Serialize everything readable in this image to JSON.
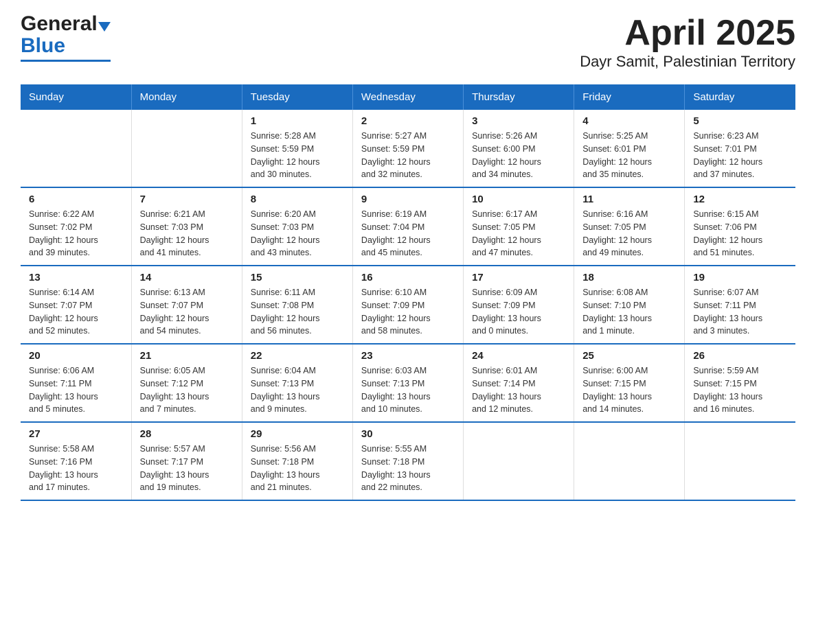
{
  "header": {
    "logo_general": "General",
    "logo_blue": "Blue",
    "title": "April 2025",
    "subtitle": "Dayr Samit, Palestinian Territory"
  },
  "calendar": {
    "days_of_week": [
      "Sunday",
      "Monday",
      "Tuesday",
      "Wednesday",
      "Thursday",
      "Friday",
      "Saturday"
    ],
    "weeks": [
      [
        {
          "day": "",
          "info": ""
        },
        {
          "day": "",
          "info": ""
        },
        {
          "day": "1",
          "info": "Sunrise: 5:28 AM\nSunset: 5:59 PM\nDaylight: 12 hours\nand 30 minutes."
        },
        {
          "day": "2",
          "info": "Sunrise: 5:27 AM\nSunset: 5:59 PM\nDaylight: 12 hours\nand 32 minutes."
        },
        {
          "day": "3",
          "info": "Sunrise: 5:26 AM\nSunset: 6:00 PM\nDaylight: 12 hours\nand 34 minutes."
        },
        {
          "day": "4",
          "info": "Sunrise: 5:25 AM\nSunset: 6:01 PM\nDaylight: 12 hours\nand 35 minutes."
        },
        {
          "day": "5",
          "info": "Sunrise: 6:23 AM\nSunset: 7:01 PM\nDaylight: 12 hours\nand 37 minutes."
        }
      ],
      [
        {
          "day": "6",
          "info": "Sunrise: 6:22 AM\nSunset: 7:02 PM\nDaylight: 12 hours\nand 39 minutes."
        },
        {
          "day": "7",
          "info": "Sunrise: 6:21 AM\nSunset: 7:03 PM\nDaylight: 12 hours\nand 41 minutes."
        },
        {
          "day": "8",
          "info": "Sunrise: 6:20 AM\nSunset: 7:03 PM\nDaylight: 12 hours\nand 43 minutes."
        },
        {
          "day": "9",
          "info": "Sunrise: 6:19 AM\nSunset: 7:04 PM\nDaylight: 12 hours\nand 45 minutes."
        },
        {
          "day": "10",
          "info": "Sunrise: 6:17 AM\nSunset: 7:05 PM\nDaylight: 12 hours\nand 47 minutes."
        },
        {
          "day": "11",
          "info": "Sunrise: 6:16 AM\nSunset: 7:05 PM\nDaylight: 12 hours\nand 49 minutes."
        },
        {
          "day": "12",
          "info": "Sunrise: 6:15 AM\nSunset: 7:06 PM\nDaylight: 12 hours\nand 51 minutes."
        }
      ],
      [
        {
          "day": "13",
          "info": "Sunrise: 6:14 AM\nSunset: 7:07 PM\nDaylight: 12 hours\nand 52 minutes."
        },
        {
          "day": "14",
          "info": "Sunrise: 6:13 AM\nSunset: 7:07 PM\nDaylight: 12 hours\nand 54 minutes."
        },
        {
          "day": "15",
          "info": "Sunrise: 6:11 AM\nSunset: 7:08 PM\nDaylight: 12 hours\nand 56 minutes."
        },
        {
          "day": "16",
          "info": "Sunrise: 6:10 AM\nSunset: 7:09 PM\nDaylight: 12 hours\nand 58 minutes."
        },
        {
          "day": "17",
          "info": "Sunrise: 6:09 AM\nSunset: 7:09 PM\nDaylight: 13 hours\nand 0 minutes."
        },
        {
          "day": "18",
          "info": "Sunrise: 6:08 AM\nSunset: 7:10 PM\nDaylight: 13 hours\nand 1 minute."
        },
        {
          "day": "19",
          "info": "Sunrise: 6:07 AM\nSunset: 7:11 PM\nDaylight: 13 hours\nand 3 minutes."
        }
      ],
      [
        {
          "day": "20",
          "info": "Sunrise: 6:06 AM\nSunset: 7:11 PM\nDaylight: 13 hours\nand 5 minutes."
        },
        {
          "day": "21",
          "info": "Sunrise: 6:05 AM\nSunset: 7:12 PM\nDaylight: 13 hours\nand 7 minutes."
        },
        {
          "day": "22",
          "info": "Sunrise: 6:04 AM\nSunset: 7:13 PM\nDaylight: 13 hours\nand 9 minutes."
        },
        {
          "day": "23",
          "info": "Sunrise: 6:03 AM\nSunset: 7:13 PM\nDaylight: 13 hours\nand 10 minutes."
        },
        {
          "day": "24",
          "info": "Sunrise: 6:01 AM\nSunset: 7:14 PM\nDaylight: 13 hours\nand 12 minutes."
        },
        {
          "day": "25",
          "info": "Sunrise: 6:00 AM\nSunset: 7:15 PM\nDaylight: 13 hours\nand 14 minutes."
        },
        {
          "day": "26",
          "info": "Sunrise: 5:59 AM\nSunset: 7:15 PM\nDaylight: 13 hours\nand 16 minutes."
        }
      ],
      [
        {
          "day": "27",
          "info": "Sunrise: 5:58 AM\nSunset: 7:16 PM\nDaylight: 13 hours\nand 17 minutes."
        },
        {
          "day": "28",
          "info": "Sunrise: 5:57 AM\nSunset: 7:17 PM\nDaylight: 13 hours\nand 19 minutes."
        },
        {
          "day": "29",
          "info": "Sunrise: 5:56 AM\nSunset: 7:18 PM\nDaylight: 13 hours\nand 21 minutes."
        },
        {
          "day": "30",
          "info": "Sunrise: 5:55 AM\nSunset: 7:18 PM\nDaylight: 13 hours\nand 22 minutes."
        },
        {
          "day": "",
          "info": ""
        },
        {
          "day": "",
          "info": ""
        },
        {
          "day": "",
          "info": ""
        }
      ]
    ]
  }
}
